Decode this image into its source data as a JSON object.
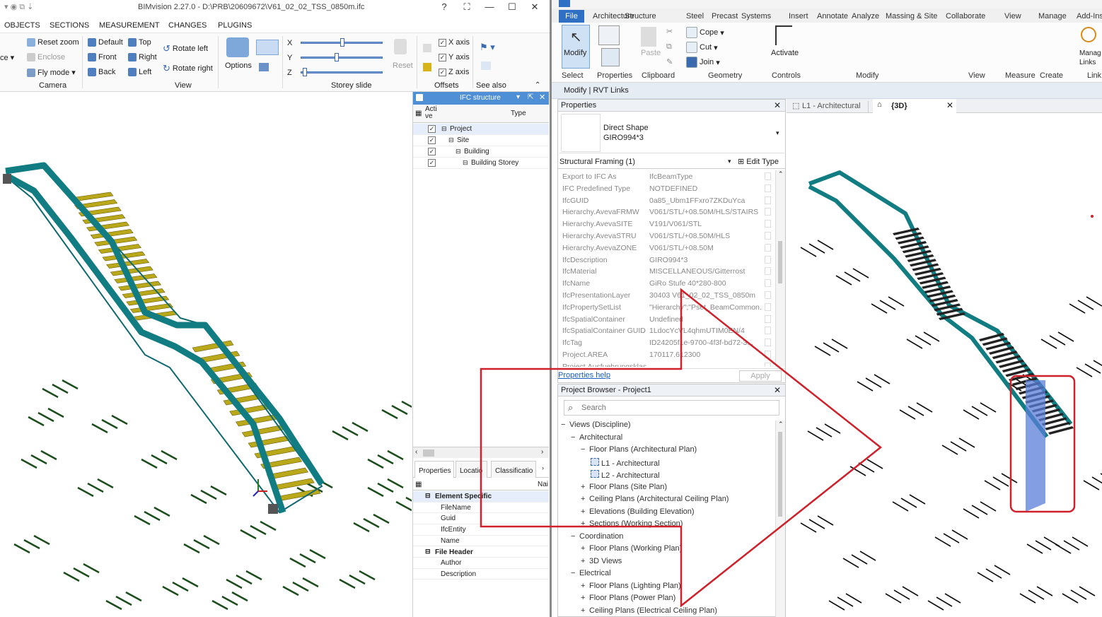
{
  "bim": {
    "title": "BIMvision 2.27.0 - D:\\PRB\\20609672\\V61_02_02_TSS_0850m.ifc",
    "window_buttons": [
      "?",
      "⛶",
      "—",
      "☐",
      "✕"
    ],
    "tabs": [
      "OBJECTS",
      "SECTIONS",
      "MEASUREMENT",
      "CHANGES",
      "PLUGINS"
    ],
    "camera": {
      "items": [
        "Reset zoom",
        "Enclose",
        "Fly mode"
      ],
      "label": "Camera",
      "ce": "ce"
    },
    "view": {
      "col1": [
        "Default",
        "Front",
        "Back"
      ],
      "col2": [
        "Top",
        "Right",
        "Left"
      ],
      "col3": [
        "Rotate left",
        "Rotate right"
      ],
      "options": "Options",
      "label": "View"
    },
    "storey": {
      "axes": [
        "X",
        "Y",
        "Z"
      ],
      "slider_levels": [
        0.5,
        0.43,
        0.02
      ],
      "reset": "Reset",
      "label": "Storey slide"
    },
    "offsets": {
      "axes": [
        "X axis",
        "Y axis",
        "Z axis"
      ],
      "label": "Offsets"
    },
    "see_also": "See also",
    "ifc_panel": {
      "title": "IFC structure",
      "col_active": "Acti ve",
      "col_type": "Type",
      "tree": [
        "Project",
        "Site",
        "Building",
        "Building Storey"
      ],
      "tabs": [
        "Properties",
        "Locatio",
        "Classificatio"
      ],
      "col_name": "Nai",
      "groups": [
        {
          "name": "Element Specific",
          "items": [
            "FileName",
            "Guid",
            "IfcEntity",
            "Name"
          ]
        },
        {
          "name": "File Header",
          "items": [
            "Author",
            "Description"
          ]
        }
      ]
    }
  },
  "revit": {
    "tabs": [
      "File",
      "Architecture",
      "Structure",
      "Steel",
      "Precast",
      "Systems",
      "Insert",
      "Annotate",
      "Analyze",
      "Massing & Site",
      "Collaborate",
      "View",
      "Manage",
      "Add-Ins"
    ],
    "ribbon": {
      "modify": "Modify",
      "cope": "Cope",
      "cut": "Cut",
      "join": "Join",
      "paste": "Paste",
      "activate": "Activate",
      "manage_links": "Manag Links",
      "groups": [
        "Select",
        "Properties",
        "Clipboard",
        "Geometry",
        "Controls",
        "Modify",
        "View",
        "Measure",
        "Create",
        "Link"
      ]
    },
    "context": "Modify | RVT Links",
    "properties": {
      "title": "Properties",
      "type_line1": "Direct Shape",
      "type_line2": "GIRO994*3",
      "category": "Structural Framing (1)",
      "edit_type": "Edit Type",
      "rows": [
        [
          "Export to IFC As",
          "IfcBeamType"
        ],
        [
          "IFC Predefined Type",
          "NOTDEFINED"
        ],
        [
          "IfcGUID",
          "0a85_Ubm1FFxro7ZKDuYca"
        ],
        [
          "Hierarchy.AvevaFRMW",
          "V061/STL/+08.50M/HLS/STAIRS"
        ],
        [
          "Hierarchy.AvevaSITE",
          "V191/V061/STL"
        ],
        [
          "Hierarchy.AvevaSTRU",
          "V061/STL/+08.50M/HLS"
        ],
        [
          "Hierarchy.AvevaZONE",
          "V061/STL/+08.50M"
        ],
        [
          "IfcDescription",
          "GIRO994*3"
        ],
        [
          "IfcMaterial",
          "MISCELLANEOUS/Gitterrost"
        ],
        [
          "IfcName",
          "GiRo Stufe 40*280-800"
        ],
        [
          "IfcPresentationLayer",
          "30403 V61_02_02_TSS_0850m"
        ],
        [
          "IfcPropertySetList",
          "\"Hierarchy\";\"Pset_BeamCommon..."
        ],
        [
          "IfcSpatialContainer",
          "Undefined"
        ],
        [
          "IfcSpatialContainer GUID",
          "1LdocYcVL4qhmUTIM0EN/4"
        ],
        [
          "IfcTag",
          "ID24205f1e-9700-4f3f-bd72-3..."
        ],
        [
          "Project.AREA",
          "170117.612300"
        ],
        [
          "Project.Ausfuehrungsklas",
          ""
        ]
      ],
      "help": "Properties help",
      "apply": "Apply"
    },
    "browser": {
      "title": "Project Browser - Project1",
      "search_placeholder": "Search",
      "items": [
        {
          "t": "Views (Discipline)",
          "lvl": 0,
          "ex": "−"
        },
        {
          "t": "Architectural",
          "lvl": 1,
          "ex": "−"
        },
        {
          "t": "Floor Plans (Architectural Plan)",
          "lvl": 2,
          "ex": "−"
        },
        {
          "t": "L1 - Architectural",
          "lvl": 3,
          "ex": ""
        },
        {
          "t": "L2 - Architectural",
          "lvl": 3,
          "ex": ""
        },
        {
          "t": "Floor Plans (Site Plan)",
          "lvl": 2,
          "ex": "+"
        },
        {
          "t": "Ceiling Plans (Architectural Ceiling Plan)",
          "lvl": 2,
          "ex": "+"
        },
        {
          "t": "Elevations (Building Elevation)",
          "lvl": 2,
          "ex": "+"
        },
        {
          "t": "Sections (Working Section)",
          "lvl": 2,
          "ex": "+"
        },
        {
          "t": "Coordination",
          "lvl": 1,
          "ex": "−"
        },
        {
          "t": "Floor Plans (Working Plan)",
          "lvl": 2,
          "ex": "+"
        },
        {
          "t": "3D Views",
          "lvl": 2,
          "ex": "+"
        },
        {
          "t": "Electrical",
          "lvl": 1,
          "ex": "−"
        },
        {
          "t": "Floor Plans (Lighting Plan)",
          "lvl": 2,
          "ex": "+"
        },
        {
          "t": "Floor Plans (Power Plan)",
          "lvl": 2,
          "ex": "+"
        },
        {
          "t": "Ceiling Plans (Electrical Ceiling Plan)",
          "lvl": 2,
          "ex": "+"
        }
      ]
    },
    "view_tabs": [
      "L1 - Architectural",
      "{3D}"
    ]
  },
  "colors": {
    "teal": "#117d83",
    "tread": "#b9a91a",
    "annotation": "#d0202a",
    "dark_tread": "#222222"
  }
}
